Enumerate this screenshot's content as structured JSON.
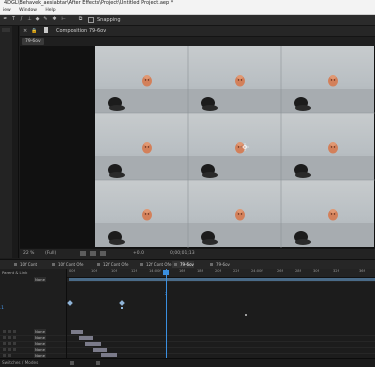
{
  "window": {
    "title": "4DGL\\Behavek_aesiabtar\\After Effects\\Project\\Untitled Project.aep *"
  },
  "menu": {
    "items": [
      "iew",
      "Window",
      "Help"
    ]
  },
  "toolbar": {
    "snapping_label": "Snapping"
  },
  "composition": {
    "header_title": "Composition 79-6ov",
    "tab_chip": "79-6ov"
  },
  "viewer": {
    "zoom": "22 %",
    "resolution": "(Full)",
    "exposure": "+0.0",
    "timecode": "0;00;01;13",
    "grid_rows": 3,
    "grid_cols": 3
  },
  "comp_tabs": [
    {
      "label": "10f Cont",
      "active": false
    },
    {
      "label": "10f Cont Ofe",
      "active": false
    },
    {
      "label": "12f Cont Ofe",
      "active": false
    },
    {
      "label": "12f Cont Ofe",
      "active": false
    },
    {
      "label": "79-6ov",
      "active": true
    },
    {
      "label": "79-6ov",
      "active": false
    }
  ],
  "timeline": {
    "ruler_ticks": [
      "00f",
      "10f",
      "10f",
      "12f",
      "14:00f",
      "16f",
      "18f",
      "20f",
      "22f",
      "24:00f",
      "26f",
      "28f",
      "30f",
      "32f",
      "36f"
    ],
    "current_marker": "2",
    "parent_link_label": "Parent & Link",
    "mode_label": "None"
  },
  "layers": [
    {
      "mode": "None"
    },
    {
      "mode": "None"
    },
    {
      "mode": "None"
    },
    {
      "mode": "None"
    },
    {
      "mode": "None"
    },
    {
      "mode": "None"
    }
  ],
  "status": {
    "left": "Switches / Modes"
  },
  "colors": {
    "accent": "#3a8fe0",
    "bar": "#7b7b8a"
  }
}
